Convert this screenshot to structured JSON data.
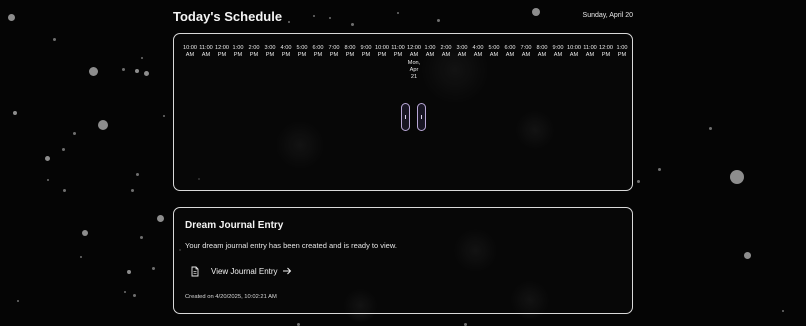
{
  "header": {
    "title": "Today's Schedule",
    "date": "Sunday, April 20"
  },
  "schedule": {
    "ticks": [
      [
        "10:00",
        "AM"
      ],
      [
        "11:00",
        "AM"
      ],
      [
        "12:00",
        "PM"
      ],
      [
        "1:00",
        "PM"
      ],
      [
        "2:00",
        "PM"
      ],
      [
        "3:00",
        "PM"
      ],
      [
        "4:00",
        "PM"
      ],
      [
        "5:00",
        "PM"
      ],
      [
        "6:00",
        "PM"
      ],
      [
        "7:00",
        "PM"
      ],
      [
        "8:00",
        "PM"
      ],
      [
        "9:00",
        "PM"
      ],
      [
        "10:00",
        "PM"
      ],
      [
        "11:00",
        "PM"
      ],
      [
        "12:00",
        "AM",
        "Mon,",
        "Apr",
        "21"
      ],
      [
        "1:00",
        "AM"
      ],
      [
        "2:00",
        "AM"
      ],
      [
        "3:00",
        "AM"
      ],
      [
        "4:00",
        "AM"
      ],
      [
        "5:00",
        "AM"
      ],
      [
        "6:00",
        "AM"
      ],
      [
        "7:00",
        "AM"
      ],
      [
        "8:00",
        "AM"
      ],
      [
        "9:00",
        "AM"
      ],
      [
        "10:00",
        "AM"
      ],
      [
        "11:00",
        "AM"
      ],
      [
        "12:00",
        "PM"
      ],
      [
        "1:00",
        "PM"
      ]
    ],
    "event_colors": {
      "border": "#b8a7d6",
      "fill": "#181523"
    }
  },
  "journal": {
    "title": "Dream Journal Entry",
    "description": "Your dream journal entry has been created and is ready to view.",
    "link_label": "View Journal Entry",
    "link_icons": [
      "document-icon",
      "arrow-right-icon"
    ],
    "created": "Created on 4/20/2025, 10:02:21 AM"
  },
  "colors": {
    "background": "#050505",
    "border": "#d9d9d9",
    "text": "#f2f2f2"
  }
}
